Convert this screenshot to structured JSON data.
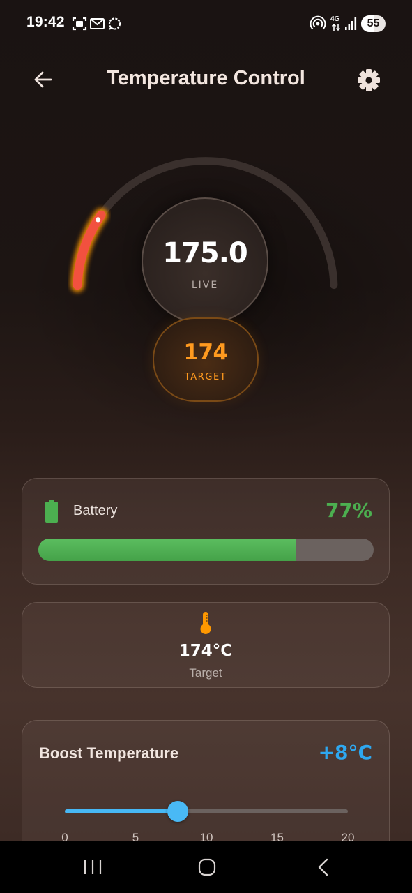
{
  "status_bar": {
    "time": "19:42",
    "notification_icons": [
      "screenshot-icon",
      "email-icon",
      "signal-messenger-icon"
    ],
    "system_icons": [
      "hotspot-icon",
      "4g-data-icon",
      "cell-signal-icon"
    ],
    "network_label": "4G",
    "battery_level": "55",
    "battery_fraction": 0.55
  },
  "header": {
    "title": "Temperature Control",
    "back_icon": "arrow-left-icon",
    "settings_icon": "gear-icon"
  },
  "gauge": {
    "live_value": "175.0",
    "live_label": "LIVE",
    "target_value": "174",
    "target_label": "TARGET",
    "progress_fraction": 0.19,
    "active_color": "#f2513f",
    "glow_color": "#ff9800",
    "track_color": "#3a302d"
  },
  "battery_card": {
    "label": "Battery",
    "percent_text": "77%",
    "level_fraction": 0.77,
    "color": "#4caf50",
    "icon": "battery-icon"
  },
  "target_card": {
    "value": "174°C",
    "label": "Target",
    "icon": "thermometer-icon",
    "icon_color": "#ff9800"
  },
  "boost_card": {
    "title": "Boost Temperature",
    "value": "+8°C",
    "slider_value": 8,
    "slider_min": 0,
    "slider_max": 20,
    "ticks": [
      "0",
      "5",
      "10",
      "15",
      "20"
    ],
    "accent_color": "#47b8f5"
  },
  "nav_bar": {
    "items": [
      "recent-apps-icon",
      "home-icon",
      "back-icon"
    ]
  }
}
